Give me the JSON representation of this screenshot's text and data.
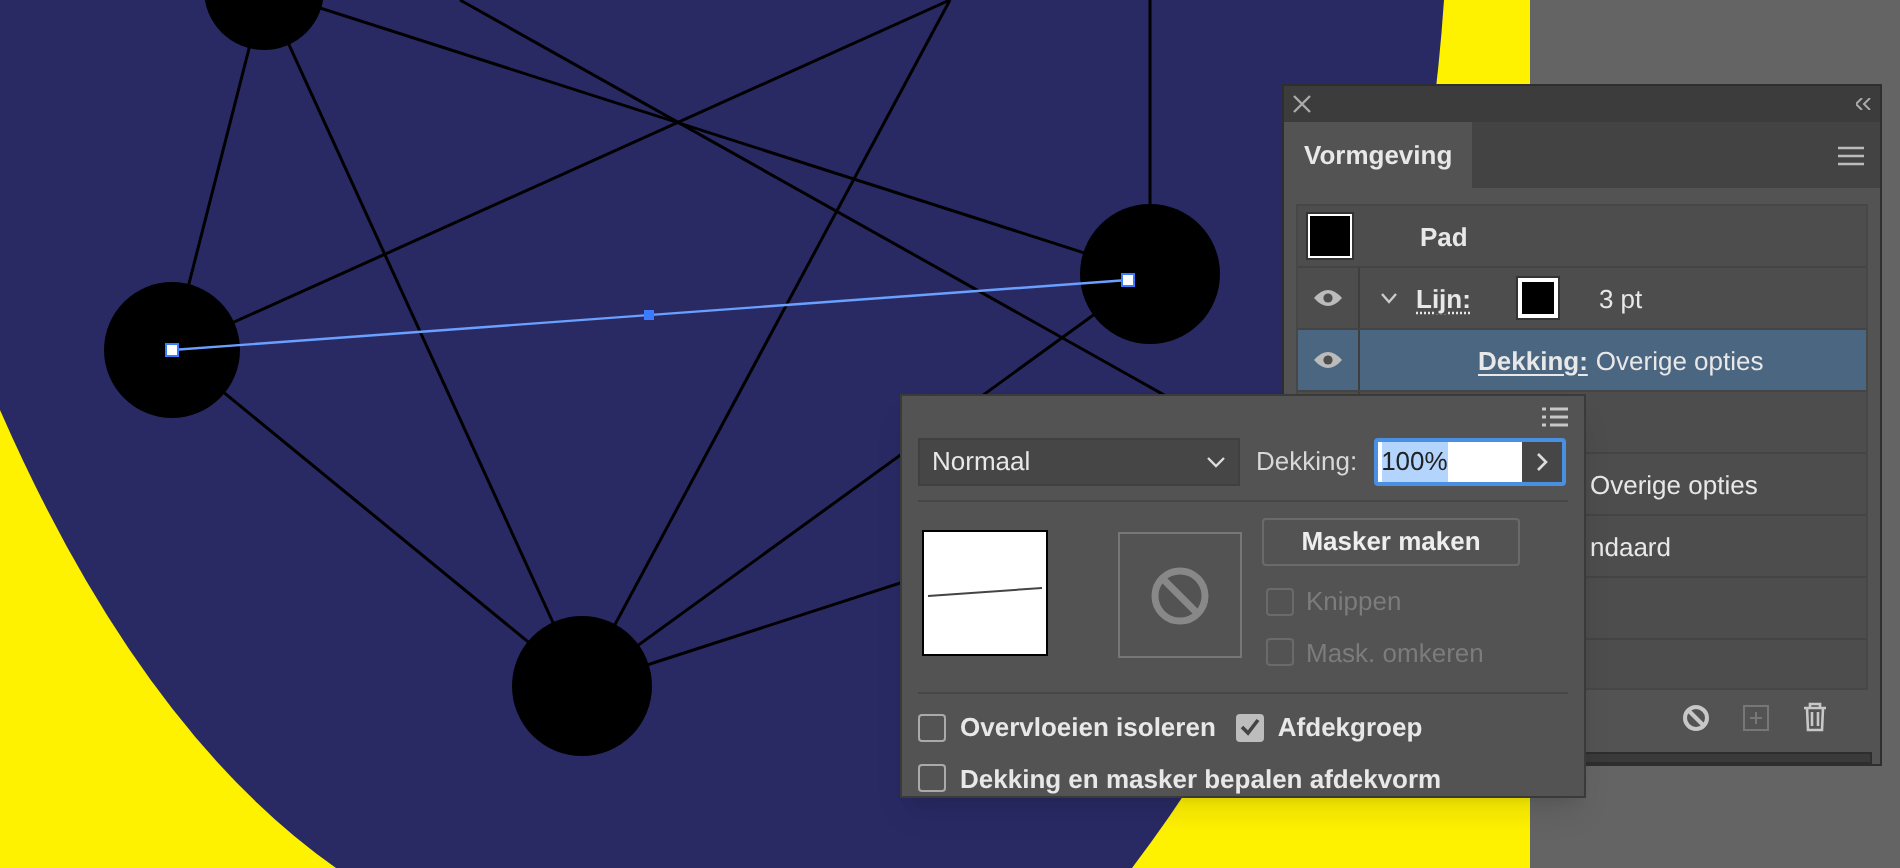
{
  "panel": {
    "title": "Vormgeving",
    "rows": [
      {
        "kind": "object",
        "label": "Pad"
      },
      {
        "kind": "stroke",
        "label": "Lijn:",
        "value": "3 pt",
        "visible": true,
        "expanded": true,
        "selected": false
      },
      {
        "kind": "opacity",
        "label": "Dekking:",
        "value": "Overige opties",
        "visible": true,
        "selected": true
      },
      {
        "kind": "blank"
      },
      {
        "kind": "partial",
        "value": "Overige opties"
      },
      {
        "kind": "partial",
        "value": "ndaard"
      },
      {
        "kind": "blank"
      }
    ]
  },
  "popup": {
    "blend_mode": "Normaal",
    "opacity_label": "Dekking:",
    "opacity_value": "100%",
    "make_mask": "Masker maken",
    "mask_options": [
      {
        "label": "Knippen",
        "checked": false,
        "disabled": true
      },
      {
        "label": "Mask. omkeren",
        "checked": false,
        "disabled": true
      }
    ],
    "options": [
      {
        "label": "Overvloeien isoleren",
        "checked": false
      },
      {
        "label": "Afdekgroep",
        "checked": true
      },
      {
        "label": "Dekking en masker bepalen afdekvorm",
        "checked": false
      }
    ]
  }
}
